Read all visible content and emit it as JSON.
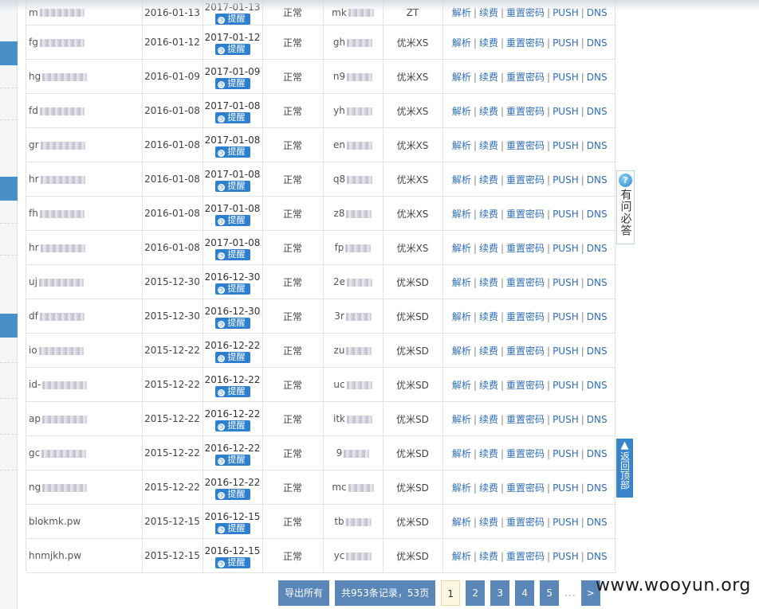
{
  "rows": [
    {
      "domain": "m",
      "reg": "2016-01-13",
      "due": "2017-01-13",
      "remind": "提醒",
      "status": "正常",
      "pw": "mk",
      "plan": "ZT"
    },
    {
      "domain": "fg",
      "reg": "2016-01-12",
      "due": "2017-01-12",
      "remind": "提醒",
      "status": "正常",
      "pw": "gh",
      "plan": "优米XS"
    },
    {
      "domain": "hg",
      "reg": "2016-01-09",
      "due": "2017-01-09",
      "remind": "提醒",
      "status": "正常",
      "pw": "n9",
      "plan": "优米XS"
    },
    {
      "domain": "fd",
      "reg": "2016-01-08",
      "due": "2017-01-08",
      "remind": "提醒",
      "status": "正常",
      "pw": "yh",
      "plan": "优米XS"
    },
    {
      "domain": "gr",
      "reg": "2016-01-08",
      "due": "2017-01-08",
      "remind": "提醒",
      "status": "正常",
      "pw": "en",
      "plan": "优米XS"
    },
    {
      "domain": "hr",
      "reg": "2016-01-08",
      "due": "2017-01-08",
      "remind": "提醒",
      "status": "正常",
      "pw": "q8",
      "plan": "优米XS"
    },
    {
      "domain": "fh",
      "reg": "2016-01-08",
      "due": "2017-01-08",
      "remind": "提醒",
      "status": "正常",
      "pw": "z8",
      "plan": "优米XS"
    },
    {
      "domain": "hr",
      "reg": "2016-01-08",
      "due": "2017-01-08",
      "remind": "提醒",
      "status": "正常",
      "pw": "fp",
      "plan": "优米XS"
    },
    {
      "domain": "uj",
      "reg": "2015-12-30",
      "due": "2016-12-30",
      "remind": "提醒",
      "status": "正常",
      "pw": "2e",
      "plan": "优米SD"
    },
    {
      "domain": "df",
      "reg": "2015-12-30",
      "due": "2016-12-30",
      "remind": "提醒",
      "status": "正常",
      "pw": "3r",
      "plan": "优米SD"
    },
    {
      "domain": "io",
      "reg": "2015-12-22",
      "due": "2016-12-22",
      "remind": "提醒",
      "status": "正常",
      "pw": "zu",
      "plan": "优米SD"
    },
    {
      "domain": "id-",
      "reg": "2015-12-22",
      "due": "2016-12-22",
      "remind": "提醒",
      "status": "正常",
      "pw": "uc",
      "plan": "优米SD"
    },
    {
      "domain": "ap",
      "reg": "2015-12-22",
      "due": "2016-12-22",
      "remind": "提醒",
      "status": "正常",
      "pw": "itk",
      "plan": "优米SD"
    },
    {
      "domain": "gc",
      "reg": "2015-12-22",
      "due": "2016-12-22",
      "remind": "提醒",
      "status": "正常",
      "pw": "9",
      "plan": "优米SD"
    },
    {
      "domain": "ng",
      "reg": "2015-12-22",
      "due": "2016-12-22",
      "remind": "提醒",
      "status": "正常",
      "pw": "mc",
      "plan": "优米SD"
    },
    {
      "domain": "blokmk.pw",
      "reg": "2015-12-15",
      "due": "2016-12-15",
      "remind": "提醒",
      "status": "正常",
      "pw": "tb",
      "plan": "优米SD"
    },
    {
      "domain": "hnmjkh.pw",
      "reg": "2015-12-15",
      "due": "2016-12-15",
      "remind": "提醒",
      "status": "正常",
      "pw": "yc",
      "plan": "优米SD"
    }
  ],
  "actions": {
    "resolve": "解析",
    "renew": "续费",
    "reset_password": "重置密码",
    "push": "PUSH",
    "dns": "DNS"
  },
  "pagination": {
    "export_label": "导出所有",
    "summary": "共953条记录，53页",
    "pages": [
      "1",
      "2",
      "3",
      "4",
      "5"
    ],
    "current": "1",
    "ellipsis": "...",
    "next": ">"
  },
  "floating": {
    "qa_label": "有问必答",
    "qa_icon": "?",
    "top_label": "返回顶部",
    "top_arrow": "▲"
  },
  "watermark": "www.wooyun.org",
  "colors": {
    "link": "#2e6db8",
    "remind_button": "#2f7fd0",
    "pager": "#5b86b8"
  }
}
